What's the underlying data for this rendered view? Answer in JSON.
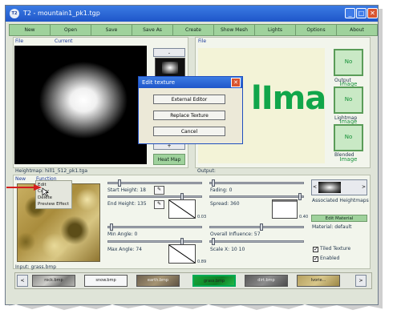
{
  "window": {
    "app_badge": "T2",
    "title": "T2 - mountain1_pk1.tgp"
  },
  "menu": [
    "New",
    "Open",
    "Save",
    "Save As",
    "Create",
    "Show Mesh",
    "Lights",
    "Options",
    "About"
  ],
  "heightmap_panel": {
    "file_label": "File",
    "current_label": "Current",
    "minus": "-",
    "plus": "+",
    "heat_map": "Heat Map",
    "caption": "Heightmap:  hill1_512_pk1.tga"
  },
  "output_panel": {
    "file_label": "File",
    "placeholder_text": "lImage",
    "thumbs": [
      {
        "text": "No Image",
        "label": "Output"
      },
      {
        "text": "No Image",
        "label": "Lightmap"
      },
      {
        "text": "No Image",
        "label": "Blended"
      }
    ],
    "caption": "Output:"
  },
  "dialog": {
    "title": "Edit texture",
    "buttons": [
      "External Editor",
      "Replace Texture",
      "Cancel"
    ]
  },
  "texture_menu": {
    "new": "New",
    "function": "Function",
    "items": [
      "Edit",
      "Copy",
      "Delete",
      "Preview Effect"
    ]
  },
  "controls": {
    "start_height": "Start Height: 18",
    "end_height": "End Height: 135",
    "end_value": "0.03",
    "fading": "Fading: 0",
    "spread": "Spread: 360",
    "spread_value": "0.40",
    "min_angle": "Min Angle: 0",
    "max_angle": "Max Angle: 74",
    "max_value": "0.89",
    "overall_influence": "Overall Influence: 57",
    "scale": "Scale X: 10  10"
  },
  "side": {
    "associated": "Associated Heightmaps",
    "edit_material": "Edit Material",
    "material": "Material: default",
    "tiled_texture": "Tiled Texture",
    "enabled": "Enabled",
    "tiled_checked": true,
    "enabled_checked": true
  },
  "input_caption": "Input:  grass.bmp",
  "textures": [
    "rock.bmp",
    "snow.bmp",
    "earth.bmp",
    "grass.bmp",
    "dirt.bmp",
    "Ivorie..."
  ],
  "colors": {
    "accent_green": "#9fd29c",
    "title_blue": "#1f56c9"
  }
}
